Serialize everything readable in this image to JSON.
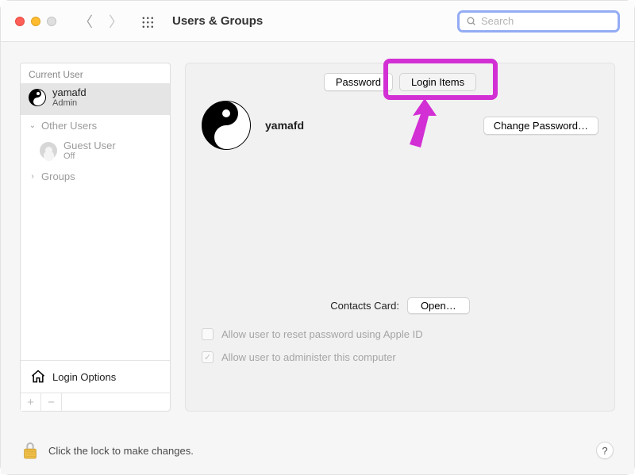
{
  "window": {
    "title": "Users & Groups"
  },
  "search": {
    "placeholder": "Search"
  },
  "sidebar": {
    "current_caption": "Current User",
    "current_user": {
      "name": "yamafd",
      "role": "Admin"
    },
    "other_caption": "Other Users",
    "guest": {
      "name": "Guest User",
      "status": "Off"
    },
    "groups_caption": "Groups",
    "login_options": "Login Options"
  },
  "tabs": {
    "password": "Password",
    "login_items": "Login Items"
  },
  "user": {
    "name": "yamafd"
  },
  "buttons": {
    "change_password": "Change Password…",
    "open": "Open…"
  },
  "labels": {
    "contacts_card": "Contacts Card:"
  },
  "checks": {
    "reset_apple_id": "Allow user to reset password using Apple ID",
    "administer": "Allow user to administer this computer"
  },
  "footer": {
    "lock_text": "Click the lock to make changes."
  }
}
